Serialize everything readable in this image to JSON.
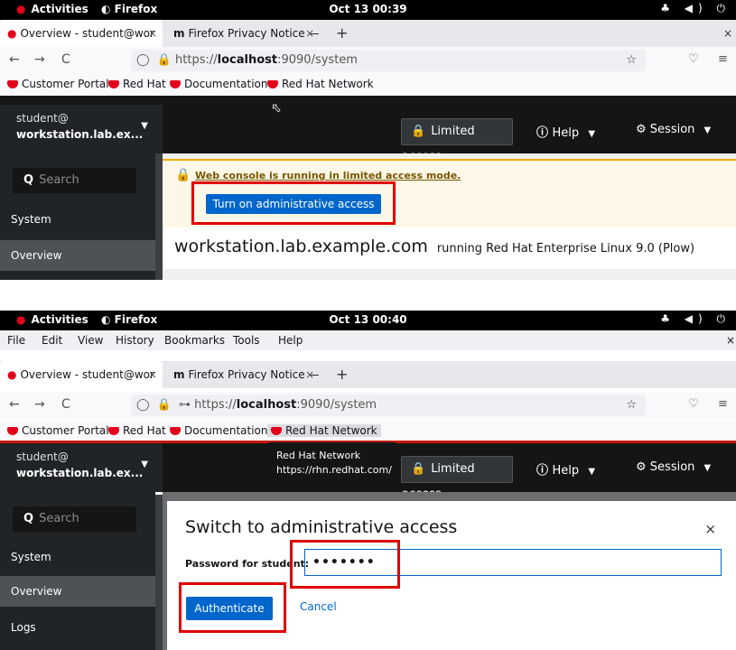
{
  "top": {
    "gnome": {
      "activities": "Activities",
      "app": "Firefox",
      "clock": "Oct 13  00:39",
      "tray": "♣ ◀) ⏻"
    },
    "tabs": [
      {
        "title": "Overview - student@wor",
        "close": "×"
      },
      {
        "title": "Firefox Privacy Notice —",
        "close": "×"
      }
    ],
    "new_tab": "+",
    "window_close": "×",
    "nav": {
      "back": "←",
      "forward": "→",
      "reload": "C"
    },
    "url": {
      "scheme": "https://",
      "host": "localhost",
      "rest": ":9090/system"
    },
    "bookmarks": [
      "Customer Portal",
      "Red Hat",
      "Documentation",
      "Red Hat Network"
    ],
    "host": {
      "user": "student@",
      "name": "workstation.lab.ex..."
    },
    "limited_access": "Limited access",
    "help": "Help",
    "session": "Session",
    "search_placeholder": "Search",
    "sidebar": [
      "System",
      "Overview"
    ],
    "alert": "Web console is running in limited access mode.",
    "admin_button": "Turn on administrative access",
    "hostname": "workstation.lab.example.com",
    "os": "running Red Hat Enterprise Linux 9.0 (Plow)"
  },
  "bottom": {
    "gnome": {
      "activities": "Activities",
      "app": "Firefox",
      "clock": "Oct 13  00:40",
      "tray": "♣ ◀) ⏻"
    },
    "menu": [
      "File",
      "Edit",
      "View",
      "History",
      "Bookmarks",
      "Tools",
      "Help"
    ],
    "tabs": [
      {
        "title": "Overview - student@wor",
        "close": "×"
      },
      {
        "title": "Firefox Privacy Notice —",
        "close": "×"
      }
    ],
    "new_tab": "+",
    "window_close": "×",
    "nav": {
      "back": "←",
      "forward": "→",
      "reload": "C"
    },
    "url": {
      "scheme": "https://",
      "host": "localhost",
      "rest": ":9090/system"
    },
    "bookmarks": [
      "Customer Portal",
      "Red Hat",
      "Documentation",
      "Red Hat Network"
    ],
    "tooltip": {
      "title": "Red Hat Network",
      "url": "https://rhn.redhat.com/"
    },
    "host": {
      "user": "student@",
      "name": "workstation.lab.ex..."
    },
    "limited_access": "Limited access",
    "help": "Help",
    "session": "Session",
    "search_placeholder": "Search",
    "sidebar": [
      "System",
      "Overview",
      "Logs"
    ],
    "modal": {
      "title": "Switch to administrative access",
      "close": "×",
      "password_label": "Password for student:",
      "password_value": "•••••••",
      "authenticate": "Authenticate",
      "cancel": "Cancel"
    }
  }
}
